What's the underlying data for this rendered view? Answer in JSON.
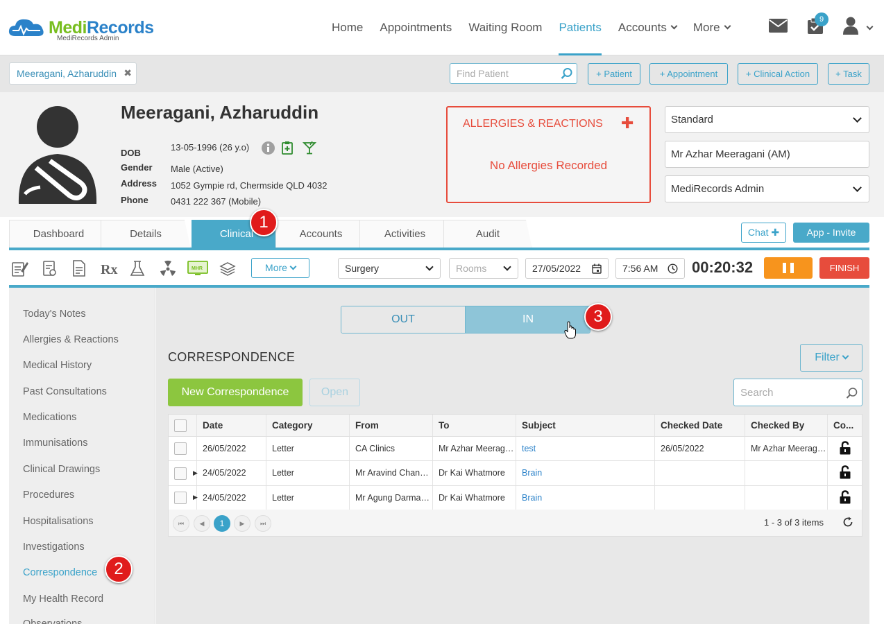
{
  "brand": {
    "part1": "Medi",
    "part2": "Records",
    "sub": "MediRecords Admin"
  },
  "nav": {
    "items": [
      "Home",
      "Appointments",
      "Waiting Room",
      "Patients",
      "Accounts",
      "More"
    ],
    "active": "Patients",
    "task_badge": "9"
  },
  "patientbar": {
    "open_patient": "Meeragani, Azharuddin",
    "find_placeholder": "Find Patient",
    "buttons": [
      "+ Patient",
      "+ Appointment",
      "+ Clinical Action",
      "+ Task"
    ]
  },
  "patient": {
    "name": "Meeragani, Azharuddin",
    "dob_label": "DOB",
    "dob": "13-05-1996 (26 y.o)",
    "gender_label": "Gender",
    "gender": "Male (Active)",
    "address_label": "Address",
    "address": "1052 Gympie rd, Chermside QLD 4032",
    "phone_label": "Phone",
    "phone": "0431 222 367 (Mobile)"
  },
  "allergies": {
    "title": "ALLERGIES & REACTIONS",
    "empty": "No Allergies Recorded"
  },
  "selectors": {
    "template": "Standard",
    "practitioner": "Mr Azhar Meeragani (AM)",
    "location": "MediRecords Admin"
  },
  "tabs": [
    "Dashboard",
    "Details",
    "Clinical",
    "Accounts",
    "Activities",
    "Audit"
  ],
  "active_tab": "Clinical",
  "chat_label": "Chat",
  "app_invite_label": "App - Invite",
  "toolbar": {
    "more_label": "More",
    "visit_type": "Surgery",
    "rooms_placeholder": "Rooms",
    "date": "27/05/2022",
    "time": "7:56 AM",
    "timer": "00:20:32",
    "finish_label": "FINISH",
    "mhr_label": "MHR"
  },
  "sidebar": {
    "items": [
      "Today's Notes",
      "Allergies & Reactions",
      "Medical History",
      "Past Consultations",
      "Medications",
      "Immunisations",
      "Clinical Drawings",
      "Procedures",
      "Hospitalisations",
      "Investigations",
      "Correspondence",
      "My Health Record",
      "Observations"
    ],
    "active": "Correspondence"
  },
  "correspondence": {
    "toggle": {
      "out": "OUT",
      "in": "IN",
      "selected": "IN"
    },
    "title": "CORRESPONDENCE",
    "filter_label": "Filter",
    "new_label": "New Correspondence",
    "open_label": "Open",
    "search_placeholder": "Search",
    "columns": [
      "Date",
      "Category",
      "From",
      "To",
      "Subject",
      "Checked Date",
      "Checked By",
      "Co..."
    ],
    "rows": [
      {
        "date": "26/05/2022",
        "category": "Letter",
        "from": "CA Clinics",
        "to": "Mr Azhar Meeragani (AM)",
        "subject": "test",
        "checked_date": "26/05/2022",
        "checked_by": "Mr Azhar Meeragani",
        "expandable": false
      },
      {
        "date": "24/05/2022",
        "category": "Letter",
        "from": "Mr Aravind Chandran",
        "to": "Dr Kai Whatmore",
        "subject": "Brain",
        "checked_date": "",
        "checked_by": "",
        "expandable": true
      },
      {
        "date": "24/05/2022",
        "category": "Letter",
        "from": "Mr Agung Darmawan",
        "to": "Dr Kai Whatmore",
        "subject": "Brain",
        "checked_date": "",
        "checked_by": "",
        "expandable": true
      }
    ],
    "pager": {
      "current_page": "1",
      "info": "1 - 3 of 3 items"
    }
  },
  "markers": [
    "1",
    "2",
    "3"
  ],
  "colors": {
    "accent": "#3aa2c9",
    "brand_green": "#78be20",
    "brand_blue": "#2b82c9",
    "alert_red": "#e74c3c",
    "pause_orange": "#f7941d",
    "new_green": "#8cc63f",
    "marker_red": "#e01b1b"
  }
}
